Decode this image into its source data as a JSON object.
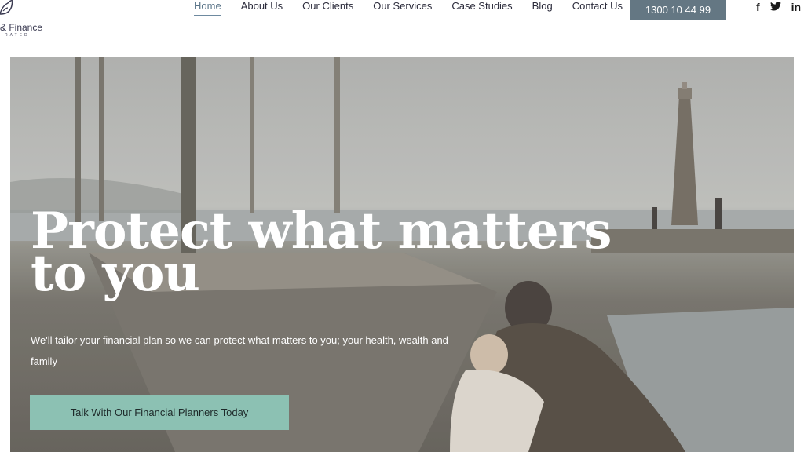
{
  "logo": {
    "name": "& Finance",
    "sub": "RATED"
  },
  "nav": {
    "items": [
      {
        "label": "Home"
      },
      {
        "label": "About Us"
      },
      {
        "label": "Our Clients"
      },
      {
        "label": "Our Services"
      },
      {
        "label": "Case Studies"
      },
      {
        "label": "Blog"
      },
      {
        "label": "Contact Us"
      }
    ],
    "active_index": 0
  },
  "phone_button": {
    "label": "1300 10 44 99"
  },
  "social": {
    "facebook": "f",
    "twitter": "🐦",
    "linkedin": "in"
  },
  "hero": {
    "title": "Protect what matters to you",
    "subtitle": "We'll tailor your financial plan so we can protect what matters to you; your health, wealth and family",
    "cta_label": "Talk With Our Financial Planners Today"
  },
  "colors": {
    "accent": "#647783",
    "cta": "#8cc1b3",
    "nav_active": "#5a7488"
  }
}
